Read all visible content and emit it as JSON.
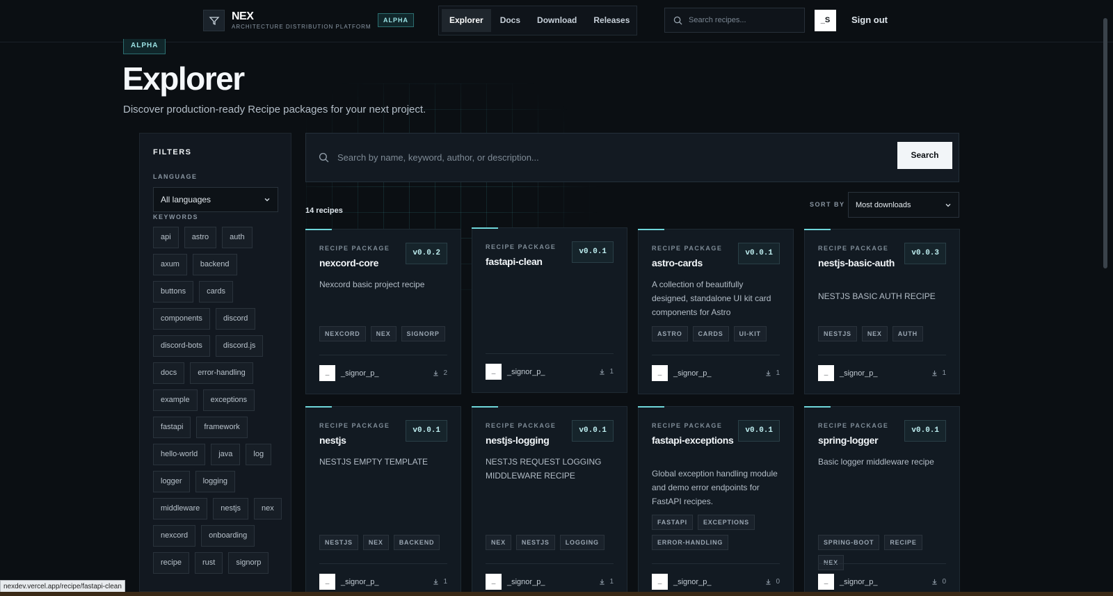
{
  "header": {
    "logo_name": "NEX",
    "logo_subtitle": "ARCHITECTURE DISTRIBUTION PLATFORM",
    "badge": "ALPHA",
    "nav": [
      {
        "label": "Explorer",
        "active": true
      },
      {
        "label": "Docs",
        "active": false
      },
      {
        "label": "Download",
        "active": false
      },
      {
        "label": "Releases",
        "active": false
      }
    ],
    "search_placeholder": "Search recipes...",
    "user_initial": "_S",
    "sign_out": "Sign out"
  },
  "hero": {
    "badge": "ALPHA",
    "title": "Explorer",
    "subtitle": "Discover production-ready Recipe packages for your next project."
  },
  "filters": {
    "title": "FILTERS",
    "language_label": "LANGUAGE",
    "language_value": "All languages",
    "keywords_label": "KEYWORDS",
    "keywords": [
      "api",
      "astro",
      "auth",
      "axum",
      "backend",
      "buttons",
      "cards",
      "components",
      "discord",
      "discord-bots",
      "discord.js",
      "docs",
      "error-handling",
      "example",
      "exceptions",
      "fastapi",
      "framework",
      "hello-world",
      "java",
      "log",
      "logger",
      "logging",
      "middleware",
      "nestjs",
      "nex",
      "nexcord",
      "onboarding",
      "recipe",
      "rust",
      "signorp"
    ]
  },
  "search": {
    "placeholder": "Search by name, keyword, author, or description...",
    "button": "Search"
  },
  "results": {
    "count": "14 recipes",
    "sort_label": "SORT BY",
    "sort_value": "Most downloads"
  },
  "cards": [
    {
      "kind": "RECIPE PACKAGE",
      "name": "nexcord-core",
      "version": "v0.0.2",
      "desc": "Nexcord basic project recipe",
      "tags": [
        "NEXCORD",
        "NEX",
        "SIGNORP"
      ],
      "author_initial": "_",
      "author": "_signor_p_",
      "downloads": "2"
    },
    {
      "kind": "RECIPE PACKAGE",
      "name": "fastapi-clean",
      "version": "v0.0.1",
      "desc": "",
      "tags": [],
      "author_initial": "_",
      "author": "_signor_p_",
      "downloads": "1"
    },
    {
      "kind": "RECIPE PACKAGE",
      "name": "astro-cards",
      "version": "v0.0.1",
      "desc": "A collection of beautifully designed, standalone UI kit card components for Astro",
      "tags": [
        "ASTRO",
        "CARDS",
        "UI-KIT"
      ],
      "author_initial": "_",
      "author": "_signor_p_",
      "downloads": "1"
    },
    {
      "kind": "RECIPE PACKAGE",
      "name": "nestjs-basic-auth",
      "version": "v0.0.3",
      "desc": "NESTJS BASIC AUTH RECIPE",
      "tags": [
        "NESTJS",
        "NEX",
        "AUTH"
      ],
      "author_initial": "_",
      "author": "_signor_p_",
      "downloads": "1"
    },
    {
      "kind": "RECIPE PACKAGE",
      "name": "nestjs",
      "version": "v0.0.1",
      "desc": "NESTJS EMPTY TEMPLATE",
      "tags": [
        "NESTJS",
        "NEX",
        "BACKEND"
      ],
      "author_initial": "_",
      "author": "_signor_p_",
      "downloads": "1"
    },
    {
      "kind": "RECIPE PACKAGE",
      "name": "nestjs-logging",
      "version": "v0.0.1",
      "desc": "NESTJS REQUEST LOGGING MIDDLEWARE RECIPE",
      "tags": [
        "NEX",
        "NESTJS",
        "LOGGING"
      ],
      "author_initial": "_",
      "author": "_signor_p_",
      "downloads": "1"
    },
    {
      "kind": "RECIPE PACKAGE",
      "name": "fastapi-exceptions",
      "version": "v0.0.1",
      "desc": "Global exception handling module and demo error endpoints for FastAPI recipes.",
      "tags": [
        "FASTAPI",
        "EXCEPTIONS",
        "ERROR-HANDLING"
      ],
      "author_initial": "_",
      "author": "_signor_p_",
      "downloads": "0"
    },
    {
      "kind": "RECIPE PACKAGE",
      "name": "spring-logger",
      "version": "v0.0.1",
      "desc": "Basic logger middleware recipe",
      "tags": [
        "SPRING-BOOT",
        "RECIPE",
        "NEX"
      ],
      "author_initial": "_",
      "author": "_signor_p_",
      "downloads": "0"
    }
  ],
  "status_url": "nexdev.vercel.app/recipe/fastapi-clean"
}
